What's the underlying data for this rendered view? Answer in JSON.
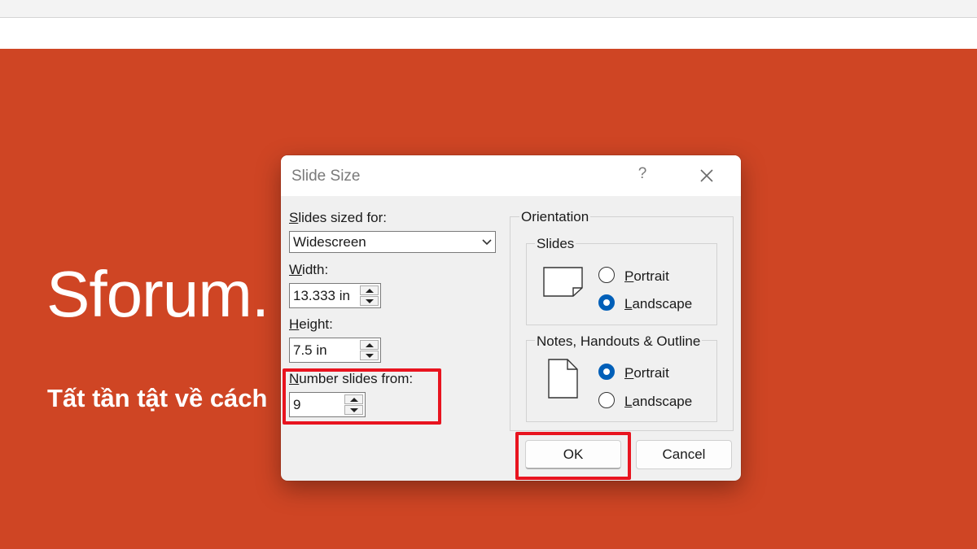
{
  "slide": {
    "title": "Sforum.",
    "subtitle": "Tất tần tật về cách"
  },
  "dialog": {
    "title": "Slide Size",
    "help_label": "?",
    "slides_sized_for": {
      "label_accel": "S",
      "label_rest": "lides sized for:",
      "value": "Widescreen"
    },
    "width": {
      "label_accel": "W",
      "label_rest": "idth:",
      "value": "13.333 in"
    },
    "height": {
      "label_accel": "H",
      "label_rest": "eight:",
      "value": "7.5 in"
    },
    "number_slides_from": {
      "label_accel": "N",
      "label_rest": "umber slides from:",
      "value": "9"
    },
    "orientation": {
      "label": "Orientation",
      "slides": {
        "label": "Slides",
        "portrait_accel": "P",
        "portrait_rest": "ortrait",
        "landscape_accel": "L",
        "landscape_rest": "andscape",
        "selected": "landscape"
      },
      "notes": {
        "label": "Notes, Handouts & Outline",
        "portrait_accel": "P",
        "portrait_rest": "ortrait",
        "landscape_accel": "L",
        "landscape_rest": "andscape",
        "selected": "portrait"
      }
    },
    "ok_label": "OK",
    "cancel_label": "Cancel"
  },
  "colors": {
    "slide_background": "#cf4524",
    "radio_selected": "#005fb8",
    "highlight_box": "#e8141f"
  }
}
